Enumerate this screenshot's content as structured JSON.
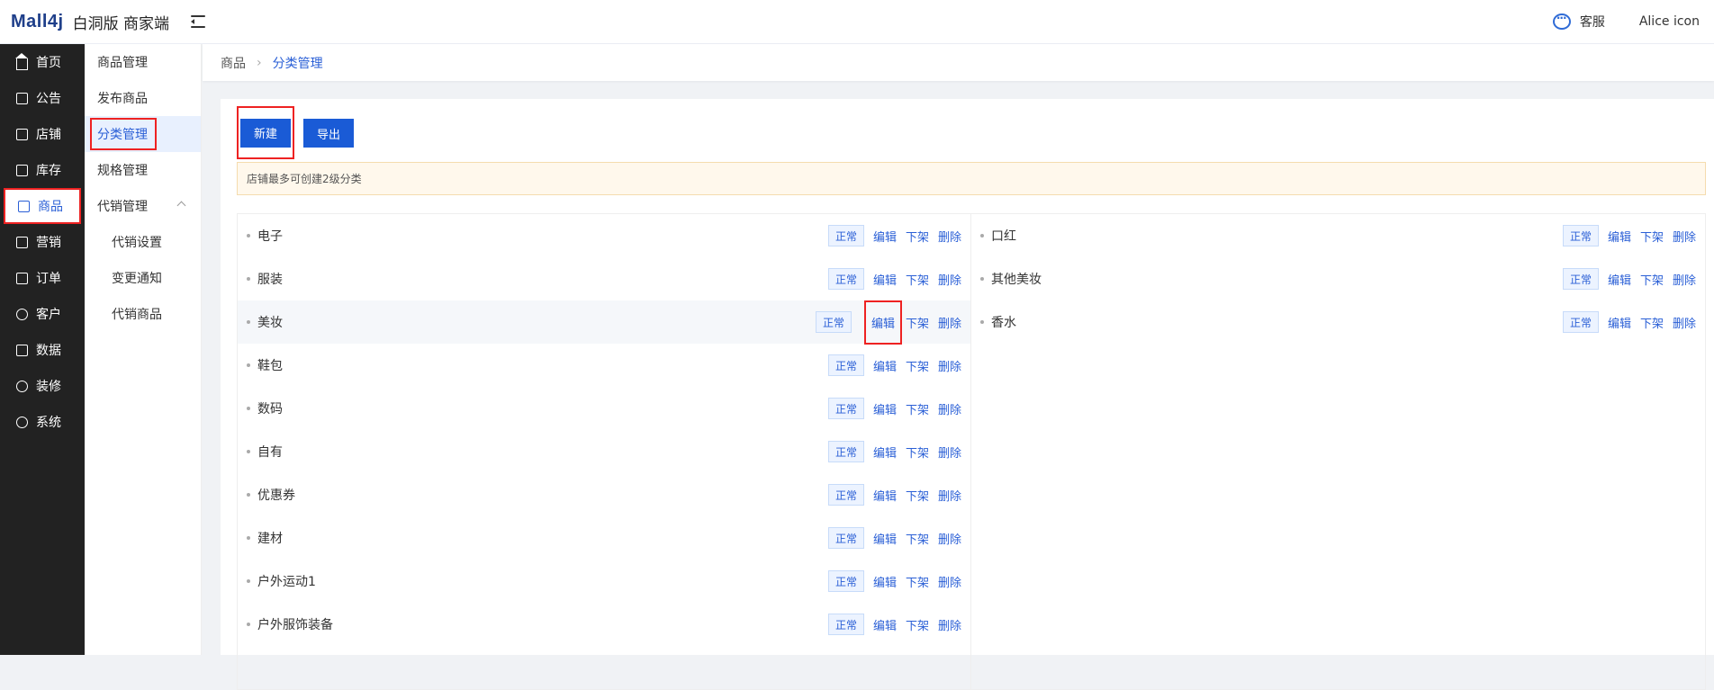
{
  "header": {
    "logo": "Mall4j",
    "subtitle": "白洞版 商家端",
    "service_label": "客服",
    "user_label": "Alice icon"
  },
  "sidebar": {
    "items": [
      {
        "label": "首页",
        "icon": "home-icon"
      },
      {
        "label": "公告",
        "icon": "notice-icon"
      },
      {
        "label": "店铺",
        "icon": "store-icon"
      },
      {
        "label": "库存",
        "icon": "inventory-icon"
      },
      {
        "label": "商品",
        "icon": "product-icon"
      },
      {
        "label": "营销",
        "icon": "gift-icon"
      },
      {
        "label": "订单",
        "icon": "order-icon"
      },
      {
        "label": "客户",
        "icon": "user-icon"
      },
      {
        "label": "数据",
        "icon": "chart-icon"
      },
      {
        "label": "装修",
        "icon": "decor-icon"
      },
      {
        "label": "系统",
        "icon": "settings-icon"
      }
    ],
    "active": "商品"
  },
  "subbar": {
    "items": [
      {
        "label": "商品管理"
      },
      {
        "label": "发布商品"
      },
      {
        "label": "分类管理"
      },
      {
        "label": "规格管理"
      },
      {
        "label": "代销管理"
      },
      {
        "label": "代销设置"
      },
      {
        "label": "变更通知"
      },
      {
        "label": "代销商品"
      }
    ]
  },
  "breadcrumb": {
    "parent": "商品",
    "current": "分类管理"
  },
  "toolbar": {
    "new_label": "新建",
    "export_label": "导出"
  },
  "notice": "店铺最多可创建2级分类",
  "ops": {
    "status": "正常",
    "edit": "编辑",
    "off": "下架",
    "delete": "删除"
  },
  "categories_left": [
    {
      "name": "电子"
    },
    {
      "name": "服装"
    },
    {
      "name": "美妆"
    },
    {
      "name": "鞋包"
    },
    {
      "name": "数码"
    },
    {
      "name": "自有"
    },
    {
      "name": "优惠券"
    },
    {
      "name": "建材"
    },
    {
      "name": "户外运动1"
    },
    {
      "name": "户外服饰装备"
    }
  ],
  "categories_right": [
    {
      "name": "口红"
    },
    {
      "name": "其他美妆"
    },
    {
      "name": "香水"
    }
  ],
  "colors": {
    "accent": "#1a5bd6",
    "link": "#2a5fd6",
    "sidebar_bg": "#222222",
    "highlight_box": "#ee2222"
  }
}
